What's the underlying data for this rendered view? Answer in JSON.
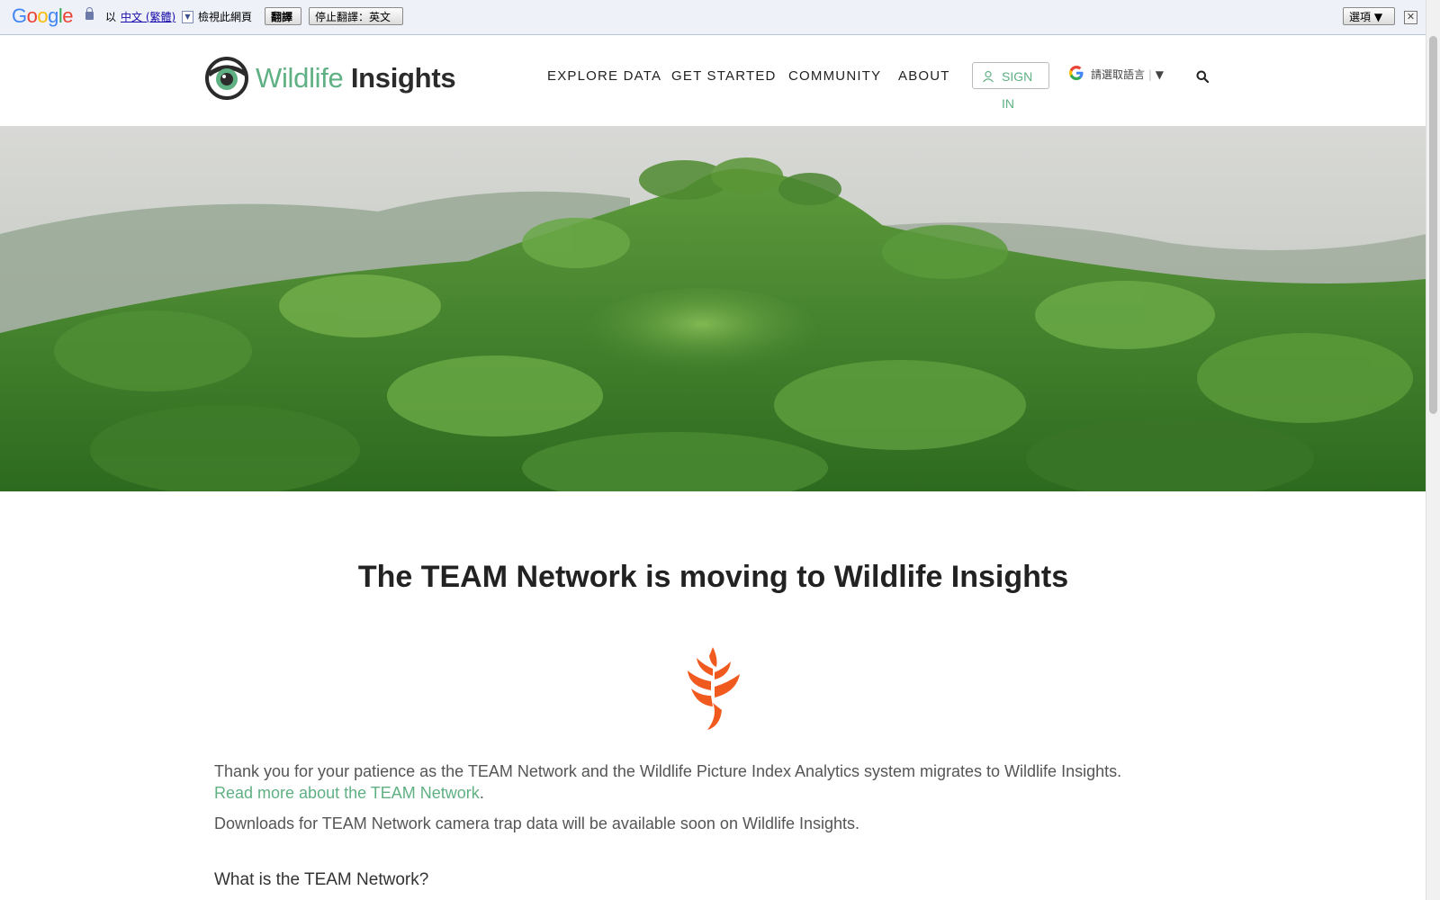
{
  "translate_bar": {
    "logo": "Google",
    "prefix": "以",
    "language": "中文 (繁體)",
    "view_text": "檢視此網頁",
    "translate_button": "翻譯",
    "stop_button": "停止翻譯：英文",
    "options_button": "選項 ▼"
  },
  "header": {
    "logo_word1": "Wildlife",
    "logo_word2": "Insights",
    "nav": [
      "EXPLORE DATA",
      "GET STARTED",
      "COMMUNITY",
      "ABOUT"
    ],
    "signin_label": "SIGN IN",
    "translate_select": "請選取語言",
    "translate_arrow": "▼"
  },
  "main": {
    "title": "The TEAM Network is moving to Wildlife Insights",
    "para1": "Thank you for your patience as the TEAM Network and the Wildlife Picture Index Analytics system migrates to Wildlife Insights.",
    "read_more_link": "Read more about the TEAM Network",
    "read_more_suffix": ".",
    "para2": "Downloads for TEAM Network camera trap data will be available soon on Wildlife Insights.",
    "subheading": "What is the TEAM Network?"
  },
  "colors": {
    "brand_green": "#5fb083",
    "heliconia_orange": "#f05a1e"
  }
}
